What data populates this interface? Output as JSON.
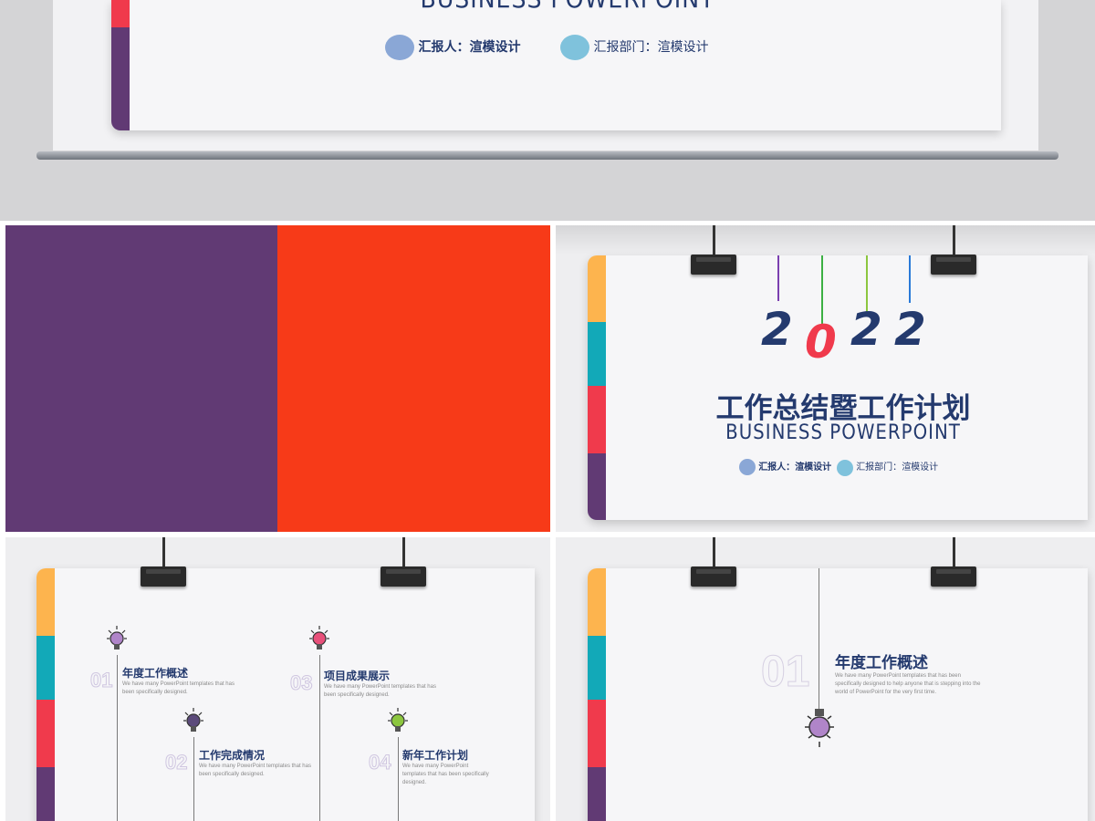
{
  "colors": {
    "purple": "#613a74",
    "orange_red": "#f73a18",
    "yellow": "#fdb44e",
    "teal": "#12a9b8",
    "red": "#f03a4c",
    "navy": "#243a6e"
  },
  "slide_top": {
    "en_title": "BUSINESS POWERPOINT",
    "reporter_label": "汇报人：",
    "reporter_value": "渲模设计",
    "dept_label": "汇报部门：",
    "dept_value": "渲模设计"
  },
  "slide_cover": {
    "year": [
      "2",
      "0",
      "2",
      "2"
    ],
    "title": "工作总结暨工作计划",
    "en_title": "BUSINESS POWERPOINT",
    "reporter_label": "汇报人：",
    "reporter_value": "渲模设计",
    "dept_label": "汇报部门：",
    "dept_value": "渲模设计"
  },
  "slide_toc": {
    "items": [
      {
        "num": "01",
        "title": "年度工作概述",
        "desc": "We have many PowerPoint templates that has been specifically designed.",
        "bulb_icon": "lightbulb-icon",
        "bulb_color": "#b085c9"
      },
      {
        "num": "02",
        "title": "工作完成情况",
        "desc": "We have many PowerPoint templates that has been specifically designed.",
        "bulb_icon": "lightbulb-icon",
        "bulb_color": "#5b4a7a"
      },
      {
        "num": "03",
        "title": "项目成果展示",
        "desc": "We have many PowerPoint templates that has been specifically designed.",
        "bulb_icon": "lightbulb-icon",
        "bulb_color": "#e8507a"
      },
      {
        "num": "04",
        "title": "新年工作计划",
        "desc": "We have many PowerPoint templates that has been specifically designed.",
        "bulb_icon": "lightbulb-icon",
        "bulb_color": "#8cc63f"
      }
    ]
  },
  "slide_section": {
    "num": "01",
    "title": "年度工作概述",
    "desc": "We have many PowerPoint templates that has been specifically designed to help anyone that is stepping into the world of PowerPoint for the very first time.",
    "bulb_color": "#b085c9"
  }
}
